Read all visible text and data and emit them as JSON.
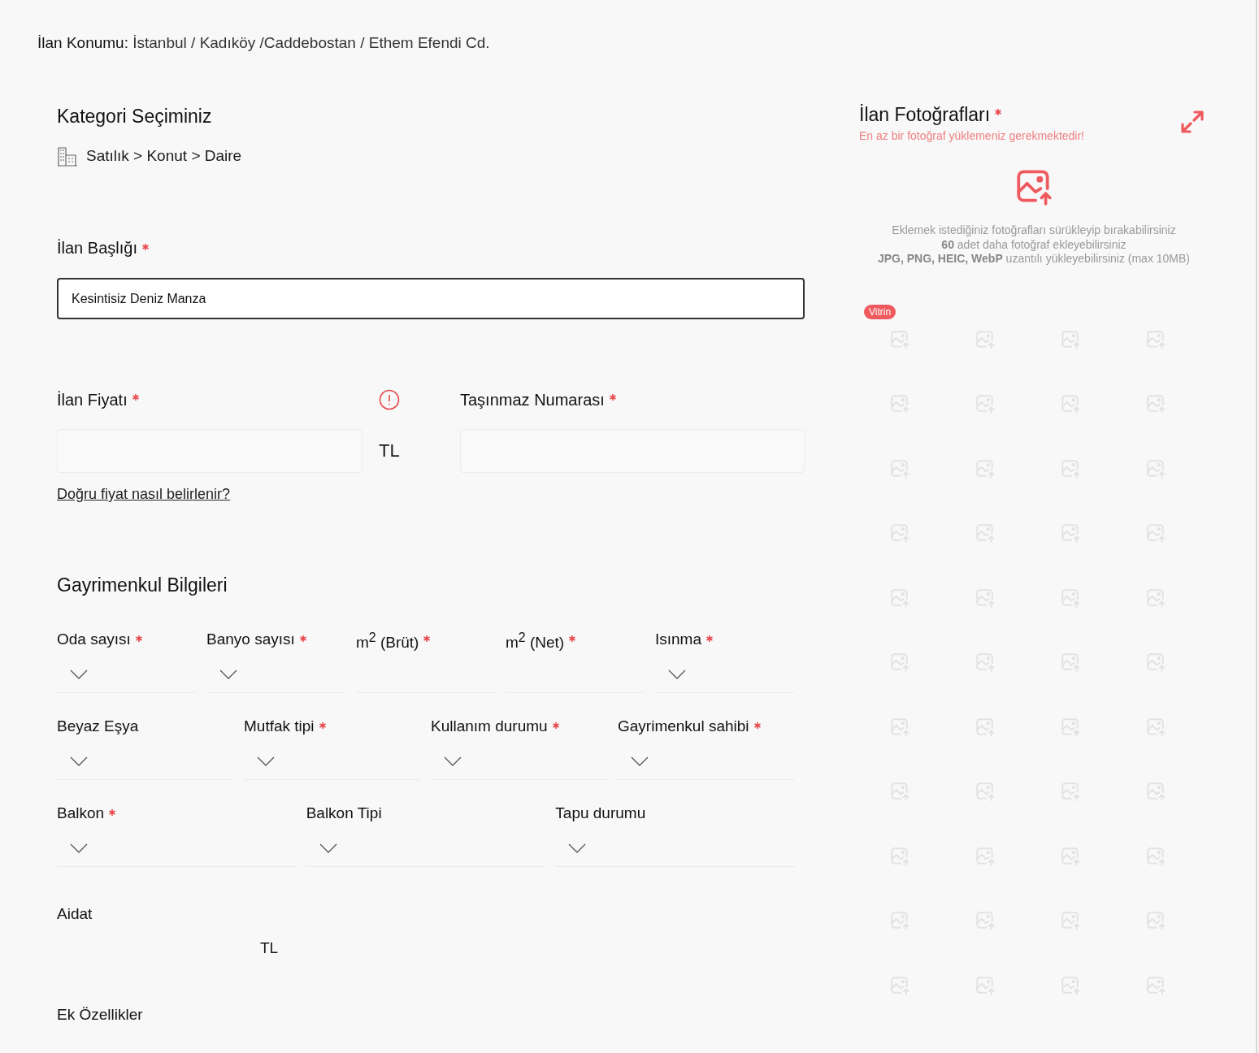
{
  "location": {
    "label": "İlan Konumu:",
    "value": "İstanbul / Kadıköy /Caddebostan / Ethem Efendi Cd."
  },
  "category": {
    "title": "Kategori Seçiminiz",
    "path": "Satılık > Konut > Daire"
  },
  "title_field": {
    "label": "İlan Başlığı",
    "required": true,
    "value": "Kesintisiz Deniz Manza"
  },
  "price": {
    "label": "İlan Fiyatı",
    "required": true,
    "warning": true,
    "currency": "TL",
    "help_link": "Doğru fiyat nasıl belirlenir?"
  },
  "parcel": {
    "label": "Taşınmaz Numarası",
    "required": true
  },
  "property": {
    "title": "Gayrimenkul Bilgileri",
    "rows": [
      {
        "fields": [
          {
            "label": "Oda sayısı",
            "required": true,
            "kind": "select"
          },
          {
            "label": "Banyo sayısı",
            "required": true,
            "kind": "select"
          },
          {
            "label": "m$^{2}$ (Brüt)",
            "required": true,
            "kind": "input"
          },
          {
            "label": "m$^{2}$ (Net)",
            "required": true,
            "kind": "input"
          },
          {
            "label": "Isınma",
            "required": true,
            "kind": "select"
          }
        ]
      },
      {
        "fields": [
          {
            "label": "Beyaz Eşya",
            "required": false,
            "kind": "select"
          },
          {
            "label": "Mutfak tipi",
            "required": true,
            "kind": "select"
          },
          {
            "label": "Kullanım durumu",
            "required": true,
            "kind": "select"
          },
          {
            "label": "Gayrimenkul sahibi",
            "required": true,
            "kind": "select"
          }
        ]
      },
      {
        "fields": [
          {
            "label": "Balkon",
            "required": true,
            "kind": "select"
          },
          {
            "label": "Balkon Tipi",
            "required": false,
            "kind": "select"
          },
          {
            "label": "Tapu durumu",
            "required": false,
            "kind": "select"
          }
        ]
      }
    ]
  },
  "aidat": {
    "label": "Aidat",
    "currency": "TL"
  },
  "extras": {
    "title": "Ek Özellikler"
  },
  "photos": {
    "title": "İlan Fotoğrafları",
    "required": true,
    "error": "En az bir fotoğraf yüklemeniz gerekmektedir!",
    "hint_lines": [
      "Eklemek istediğiniz fotoğrafları sürükleyip bırakabilirsiniz",
      "**60** adet daha fotoğraf ekleyebilirsiniz",
      "**JPG, PNG, HEIC, WebP** uzantılı yükleyebilirsiniz (max 10MB)"
    ],
    "badge": "Vitrin"
  }
}
